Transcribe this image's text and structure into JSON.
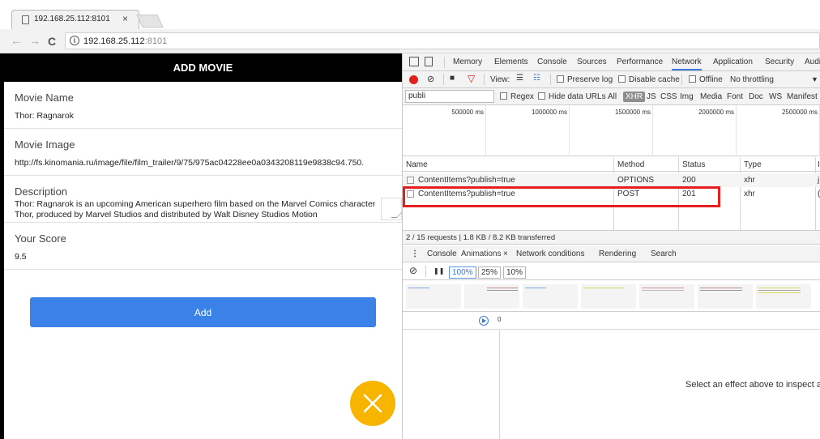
{
  "browser": {
    "tab_title": "192.168.25.112:8101",
    "tab_close": "×",
    "url_host": "192.168.25.112",
    "url_port": ":8101",
    "back": "←",
    "forward": "→",
    "reload": "C",
    "info": "i"
  },
  "app": {
    "header": "ADD MOVIE",
    "fields": [
      {
        "label": "Movie Name",
        "value": "Thor: Ragnarok"
      },
      {
        "label": "Movie Image",
        "value": "http://fs.kinomania.ru/image/file/film_trailer/9/75/975ac04228ee0a0343208119e9838c94.750."
      },
      {
        "label": "Description",
        "value": "Thor: Ragnarok is an upcoming American superhero film based on the Marvel Comics character Thor, produced by Marvel Studios and distributed by Walt Disney Studios Motion"
      },
      {
        "label": "Your Score",
        "value": "9.5"
      }
    ],
    "add_label": "Add"
  },
  "devtools": {
    "tabs": [
      "Memory",
      "Elements",
      "Console",
      "Sources",
      "Performance",
      "Network",
      "Application",
      "Security",
      "Audi"
    ],
    "active_tab": "Network",
    "toolbar": {
      "view": "View:",
      "preserve_log": "Preserve log",
      "disable_cache": "Disable cache",
      "offline": "Offline",
      "throttling": "No throttling",
      "dropdown": "▼"
    },
    "filter": {
      "value": "publi",
      "regex": "Regex",
      "hide_data_urls": "Hide data URLs",
      "types": [
        "All",
        "XHR",
        "JS",
        "CSS",
        "Img",
        "Media",
        "Font",
        "Doc",
        "WS",
        "Manifest"
      ]
    },
    "timeline_ticks": [
      "500000 ms",
      "1000000 ms",
      "1500000 ms",
      "2000000 ms",
      "2500000 ms"
    ],
    "columns": [
      "Name",
      "Method",
      "Status",
      "Type",
      "I"
    ],
    "rows": [
      {
        "name": "ContentItems?publish=true",
        "method": "OPTIONS",
        "status": "200",
        "type": "xhr",
        "extra": "j"
      },
      {
        "name": "ContentItems?publish=true",
        "method": "POST",
        "status": "201",
        "type": "xhr",
        "extra": "("
      }
    ],
    "summary": "2 / 15 requests  |  1.8 KB / 8.2 KB transferred",
    "drawer_tabs": [
      "Console",
      "Animations",
      "Network conditions",
      "Rendering",
      "Search"
    ],
    "drawer_more": "⋮",
    "drawer_close": "×",
    "pause": "❚❚",
    "speeds": [
      "100%",
      "25%",
      "10%"
    ],
    "timeline_zero": "0",
    "inspect_msg": "Select an effect above to inspect a"
  },
  "colors": {
    "accent": "#3b82e8",
    "fab": "#f7b500",
    "highlight": "#e61e1e",
    "record": "#e0221a"
  }
}
